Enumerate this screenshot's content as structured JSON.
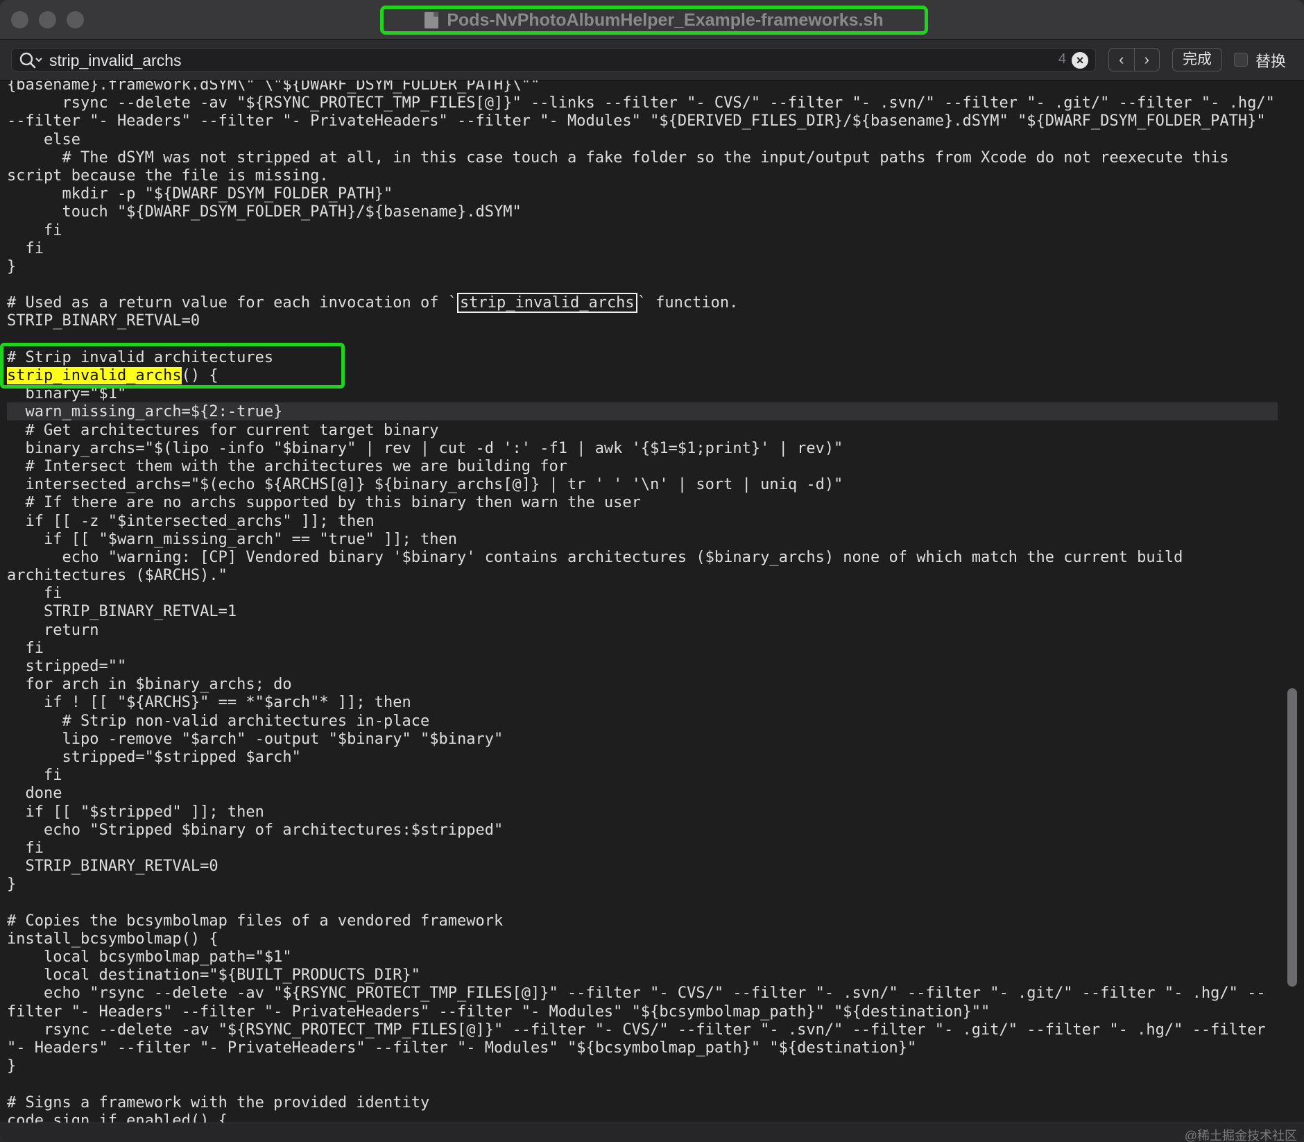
{
  "window": {
    "title": "Pods-NvPhotoAlbumHelper_Example-frameworks.sh"
  },
  "findbar": {
    "search_value": "strip_invalid_archs",
    "match_count": "4",
    "clear_icon": "×",
    "prev_icon": "‹",
    "next_icon": "›",
    "done_label": "完成",
    "replace_label": "替换"
  },
  "code": {
    "l0": "{basename}.framework.dSYM\\\" \\\"${DWARF_DSYM_FOLDER_PATH}\\\"\"",
    "l1": "      rsync --delete -av \"${RSYNC_PROTECT_TMP_FILES[@]}\" --links --filter \"- CVS/\" --filter \"- .svn/\" --filter \"- .git/\" --filter \"- .hg/\"",
    "l2": "--filter \"- Headers\" --filter \"- PrivateHeaders\" --filter \"- Modules\" \"${DERIVED_FILES_DIR}/${basename}.dSYM\" \"${DWARF_DSYM_FOLDER_PATH}\"",
    "l3": "    else",
    "l4": "      # The dSYM was not stripped at all, in this case touch a fake folder so the input/output paths from Xcode do not reexecute this",
    "l5": "script because the file is missing.",
    "l6": "      mkdir -p \"${DWARF_DSYM_FOLDER_PATH}\"",
    "l7": "      touch \"${DWARF_DSYM_FOLDER_PATH}/${basename}.dSYM\"",
    "l8": "    fi",
    "l9": "  fi",
    "l10": "}",
    "l11": "",
    "l12a": "# Used as a return value for each invocation of `",
    "l12b": "strip_invalid_archs",
    "l12c": "` function.",
    "l13": "STRIP_BINARY_RETVAL=0",
    "l14": "",
    "l15": "# Strip invalid architectures",
    "l16a": "strip_invalid_archs",
    "l16b": "() {",
    "l17": "  binary=\"$1\"",
    "l18": "  warn_missing_arch=${2:-true}",
    "l19": "  # Get architectures for current target binary",
    "l20": "  binary_archs=\"$(lipo -info \"$binary\" | rev | cut -d ':' -f1 | awk '{$1=$1;print}' | rev)\"",
    "l21": "  # Intersect them with the architectures we are building for",
    "l22": "  intersected_archs=\"$(echo ${ARCHS[@]} ${binary_archs[@]} | tr ' ' '\\n' | sort | uniq -d)\"",
    "l23": "  # If there are no archs supported by this binary then warn the user",
    "l24": "  if [[ -z \"$intersected_archs\" ]]; then",
    "l25": "    if [[ \"$warn_missing_arch\" == \"true\" ]]; then",
    "l26": "      echo \"warning: [CP] Vendored binary '$binary' contains architectures ($binary_archs) none of which match the current build",
    "l27": "architectures ($ARCHS).\"",
    "l28": "    fi",
    "l29": "    STRIP_BINARY_RETVAL=1",
    "l30": "    return",
    "l31": "  fi",
    "l32": "  stripped=\"\"",
    "l33": "  for arch in $binary_archs; do",
    "l34": "    if ! [[ \"${ARCHS}\" == *\"$arch\"* ]]; then",
    "l35": "      # Strip non-valid architectures in-place",
    "l36": "      lipo -remove \"$arch\" -output \"$binary\" \"$binary\"",
    "l37": "      stripped=\"$stripped $arch\"",
    "l38": "    fi",
    "l39": "  done",
    "l40": "  if [[ \"$stripped\" ]]; then",
    "l41": "    echo \"Stripped $binary of architectures:$stripped\"",
    "l42": "  fi",
    "l43": "  STRIP_BINARY_RETVAL=0",
    "l44": "}",
    "l45": "",
    "l46": "# Copies the bcsymbolmap files of a vendored framework",
    "l47": "install_bcsymbolmap() {",
    "l48": "    local bcsymbolmap_path=\"$1\"",
    "l49": "    local destination=\"${BUILT_PRODUCTS_DIR}\"",
    "l50": "    echo \"rsync --delete -av \"${RSYNC_PROTECT_TMP_FILES[@]}\" --filter \"- CVS/\" --filter \"- .svn/\" --filter \"- .git/\" --filter \"- .hg/\" --",
    "l51": "filter \"- Headers\" --filter \"- PrivateHeaders\" --filter \"- Modules\" \"${bcsymbolmap_path}\" \"${destination}\"\"",
    "l52": "    rsync --delete -av \"${RSYNC_PROTECT_TMP_FILES[@]}\" --filter \"- CVS/\" --filter \"- .svn/\" --filter \"- .git/\" --filter \"- .hg/\" --filter",
    "l53": "\"- Headers\" --filter \"- PrivateHeaders\" --filter \"- Modules\" \"${bcsymbolmap_path}\" \"${destination}\"",
    "l54": "}",
    "l55": "",
    "l56": "# Signs a framework with the provided identity",
    "l57": "code_sign_if_enabled() {"
  },
  "watermark": "@稀土掘金技术社区"
}
